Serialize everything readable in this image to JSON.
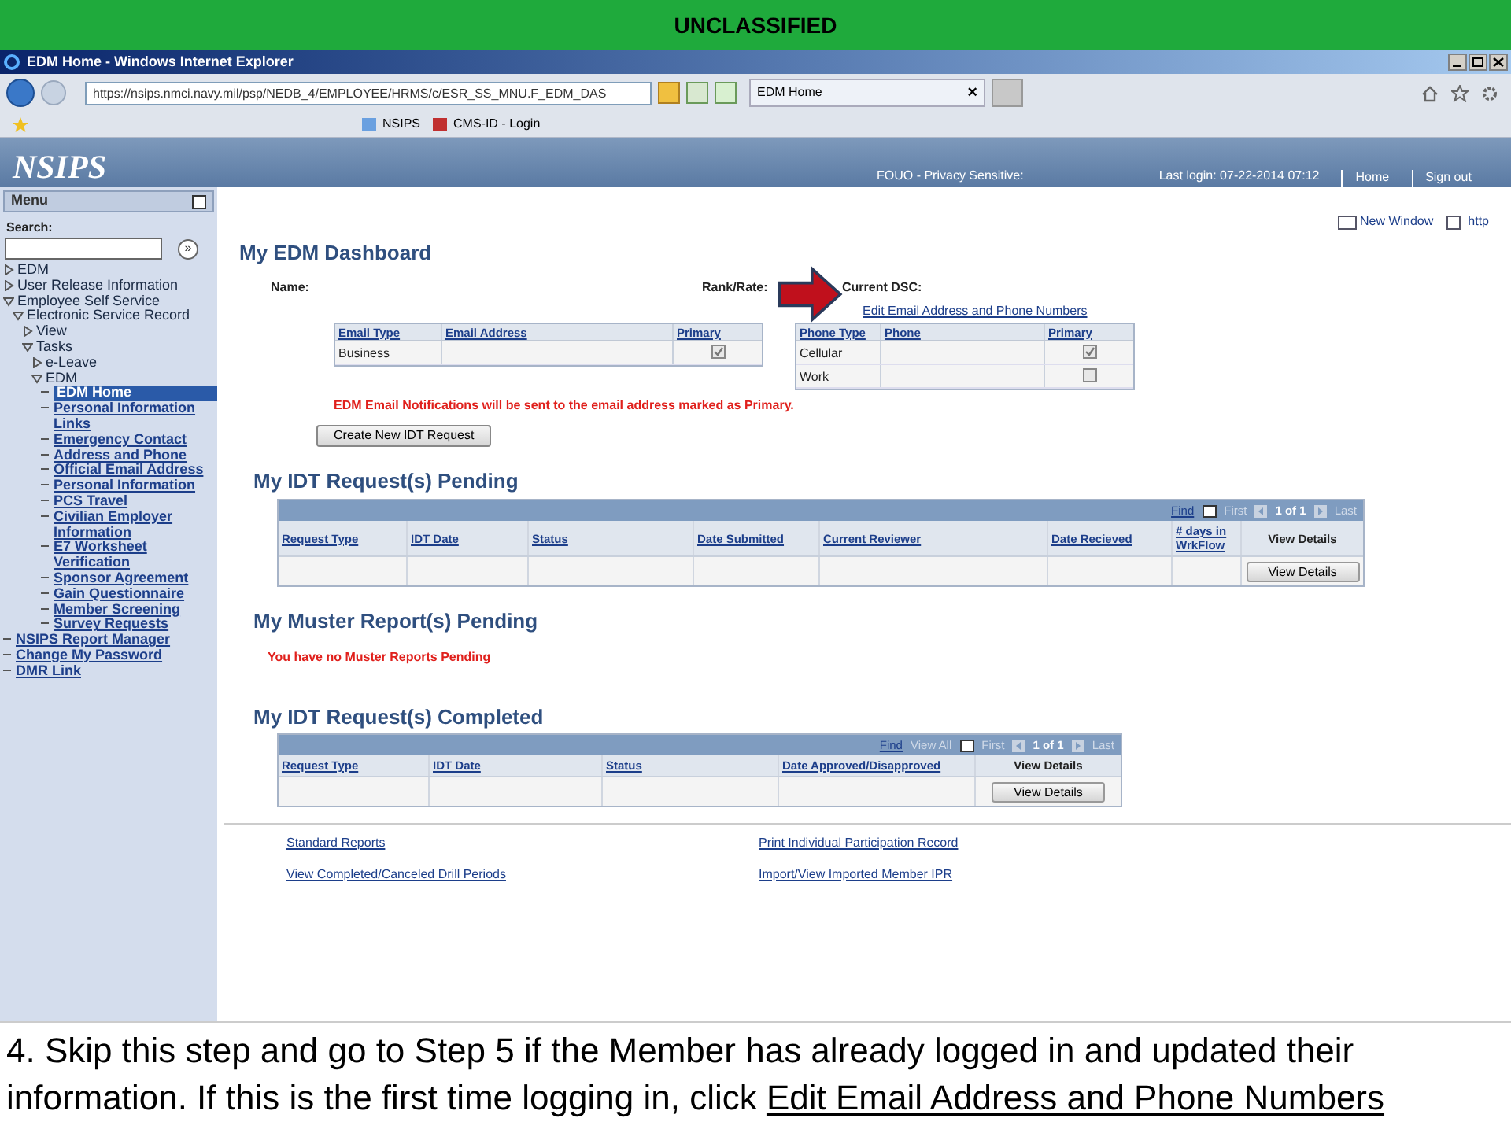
{
  "banner": "UNCLASSIFIED",
  "window": {
    "title": "EDM Home - Windows Internet Explorer"
  },
  "browser": {
    "address": "https://nsips.nmci.navy.mil/psp/NEDB_4/EMPLOYEE/HRMS/c/ESR_SS_MNU.F_EDM_DAS",
    "tab": "EDM Home",
    "tab_close": "×",
    "favorites": [
      "NSIPS",
      "CMS-ID - Login"
    ]
  },
  "header": {
    "logo": "NSIPS",
    "notice": "FOUO - Privacy Sensitive:",
    "last_login": "Last login: 07-22-2014 07:12",
    "links": [
      "Home",
      "Sign out"
    ]
  },
  "sidebar": {
    "title": "Menu",
    "search_label": "Search:",
    "search_button": "»",
    "items": [
      {
        "kind": "folder",
        "label": "EDM",
        "expanded": false
      },
      {
        "kind": "folder",
        "label": "User Release Information",
        "expanded": false
      },
      {
        "kind": "folder",
        "label": "Employee Self Service",
        "expanded": true,
        "children": [
          {
            "kind": "folder",
            "label": "Electronic Service Record",
            "expanded": true,
            "children": [
              {
                "kind": "folder",
                "label": "View",
                "expanded": false
              },
              {
                "kind": "folder",
                "label": "Tasks",
                "expanded": true,
                "children": [
                  {
                    "kind": "folder",
                    "label": "e-Leave",
                    "expanded": false
                  },
                  {
                    "kind": "folder",
                    "label": "EDM",
                    "expanded": true,
                    "children": [
                      {
                        "kind": "link",
                        "label": "EDM Home",
                        "selected": true
                      },
                      {
                        "kind": "link",
                        "label": "Personal Information Links",
                        "selected": false
                      },
                      {
                        "kind": "link",
                        "label": "Emergency Contact",
                        "selected": false
                      },
                      {
                        "kind": "link",
                        "label": "Address and Phone",
                        "selected": false
                      },
                      {
                        "kind": "link",
                        "label": "Official Email Address",
                        "selected": false
                      },
                      {
                        "kind": "link",
                        "label": "Personal Information",
                        "selected": false
                      },
                      {
                        "kind": "link",
                        "label": "PCS Travel",
                        "selected": false
                      },
                      {
                        "kind": "link",
                        "label": "Civilian Employer Information",
                        "selected": false
                      },
                      {
                        "kind": "link",
                        "label": "E7 Worksheet Verification",
                        "selected": false
                      },
                      {
                        "kind": "link",
                        "label": "Sponsor Agreement",
                        "selected": false
                      },
                      {
                        "kind": "link",
                        "label": "Gain Questionnaire",
                        "selected": false
                      },
                      {
                        "kind": "link",
                        "label": "Member Screening",
                        "selected": false
                      },
                      {
                        "kind": "link",
                        "label": "Survey Requests",
                        "selected": false
                      }
                    ]
                  }
                ]
              }
            ]
          }
        ]
      },
      {
        "kind": "link",
        "label": "NSIPS Report Manager",
        "selected": false
      },
      {
        "kind": "link",
        "label": "Change My Password",
        "selected": false
      },
      {
        "kind": "link",
        "label": "DMR Link",
        "selected": false
      }
    ]
  },
  "top_links": [
    "New Window",
    "http"
  ],
  "dashboard": {
    "title": "My EDM Dashboard",
    "name_label": "Name:",
    "rank_label": "Rank/Rate:",
    "dsc_label": "Current DSC:",
    "edit_link": "Edit Email Address and Phone Numbers",
    "email_table": {
      "columns": [
        "Email Type",
        "Email Address",
        "Primary"
      ],
      "rows": [
        {
          "cells": [
            "Business",
            ""
          ],
          "primary": true
        }
      ]
    },
    "phone_table": {
      "columns": [
        "Phone Type",
        "Phone",
        "Primary"
      ],
      "rows": [
        {
          "cells": [
            "Cellular",
            ""
          ],
          "primary": true
        },
        {
          "cells": [
            "Work",
            ""
          ],
          "primary": false
        }
      ]
    },
    "notice": "EDM Email Notifications will be sent to the email address marked as Primary.",
    "create_button": "Create New IDT Request"
  },
  "pending": {
    "title": "My IDT Request(s) Pending",
    "nav": [
      "Find",
      "First",
      "1 of 1",
      "Last"
    ],
    "columns": [
      "Request Type",
      "IDT Date",
      "Status",
      "Date Submitted",
      "Current Reviewer",
      "Date Recieved",
      "# days in WrkFlow",
      "View Details"
    ],
    "button": "View Details"
  },
  "muster": {
    "title": "My Muster Report(s) Pending",
    "message": "You have no Muster Reports Pending"
  },
  "completed": {
    "title": "My IDT Request(s) Completed",
    "nav": [
      "Find",
      "View All",
      "First",
      "1 of 1",
      "Last"
    ],
    "columns": [
      "Request Type",
      "IDT Date",
      "Status",
      "Date Approved/Disapproved",
      "View Details"
    ],
    "button": "View Details"
  },
  "footer_links": [
    "Standard Reports",
    "Print Individual Participation Record",
    "View Completed/Canceled Drill Periods",
    "Import/View Imported Member IPR"
  ],
  "caption": {
    "text": "4. Skip this step and go to Step 5 if the Member has already logged in and updated their information. If this is the first time logging in, click",
    "link": "Edit Email Address and Phone Numbers"
  }
}
